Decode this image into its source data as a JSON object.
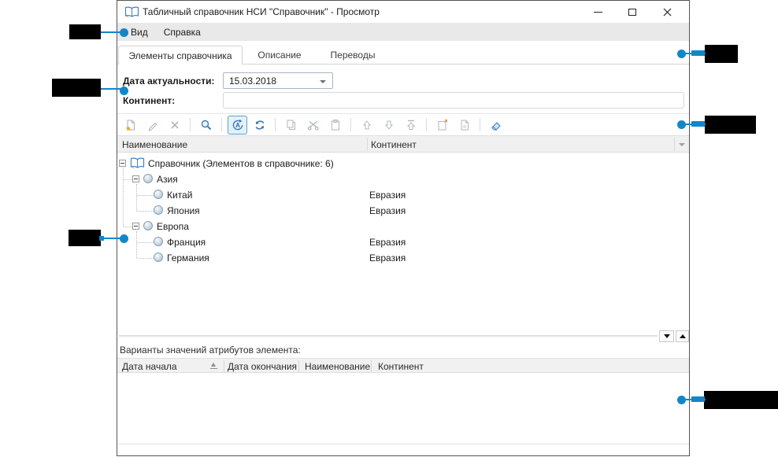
{
  "colors": {
    "accent_blue": "#1287c8",
    "annotation_black": "#000000",
    "toolbar_icon_grey": "#a9adb2",
    "toolbar_icon_blue": "#3f7bb9",
    "menu_bg": "#e9e9e9",
    "header_bg": "#f0f0f0"
  },
  "window": {
    "title": "Табличный справочник НСИ \"Справочник\" - Просмотр",
    "controls": [
      "minimize",
      "maximize",
      "close"
    ]
  },
  "menu": {
    "items": [
      "Вид",
      "Справка"
    ]
  },
  "tabs": {
    "items": [
      {
        "label": "Элементы справочника",
        "active": true
      },
      {
        "label": "Описание",
        "active": false
      },
      {
        "label": "Переводы",
        "active": false
      }
    ]
  },
  "form": {
    "date_label": "Дата актуальности:",
    "date_value": "15.03.2018",
    "continent_label": "Континент:",
    "continent_value": ""
  },
  "toolbar": {
    "buttons": [
      "new-item",
      "edit",
      "delete",
      "search",
      "auto-search",
      "refresh",
      "copy",
      "cut",
      "paste",
      "move-up",
      "move-down",
      "move-to-top",
      "open-card",
      "document",
      "clear"
    ],
    "active_button": "auto-search"
  },
  "tree": {
    "columns": [
      "Наименование",
      "Континент"
    ],
    "root_label": "Справочник (Элементов в справочнике: 6)",
    "rows": [
      {
        "label": "Азия",
        "continent": ""
      },
      {
        "label": "Китай",
        "continent": "Евразия"
      },
      {
        "label": "Япония",
        "continent": "Евразия"
      },
      {
        "label": "Европа",
        "continent": ""
      },
      {
        "label": "Франция",
        "continent": "Евразия"
      },
      {
        "label": "Германия",
        "continent": "Евразия"
      }
    ]
  },
  "variants": {
    "label": "Варианты значений атрибутов элемента:",
    "columns": [
      "Дата начала",
      "Дата окончания",
      "Наименование",
      "Континент"
    ],
    "rows": []
  }
}
